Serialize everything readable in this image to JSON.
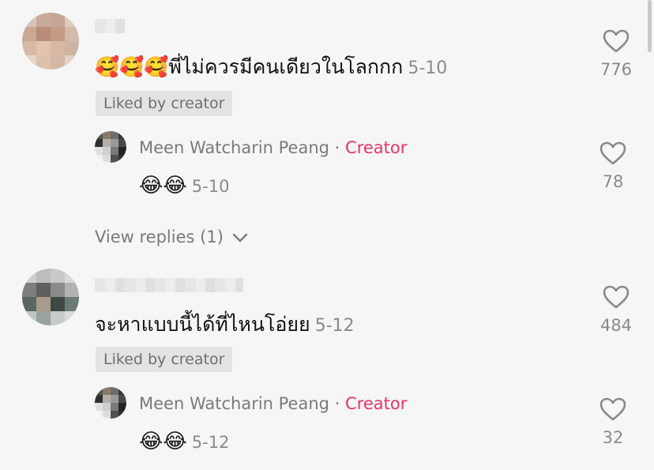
{
  "comments": [
    {
      "text": "🥰🥰🥰พี่ไม่ควรมีคนเดียวในโลกกก",
      "date": "5-10",
      "liked_label": "Liked by creator",
      "likes": "776",
      "reply": {
        "author": "Meen Watcharin Peang",
        "separator": " · ",
        "badge": "Creator",
        "text": "😂😂",
        "date": "5-10",
        "likes": "78"
      },
      "view_replies": "View replies (1)"
    },
    {
      "text": "จะหาแบบนี้ได้ที่ไหนโอ่ยย",
      "date": "5-12",
      "liked_label": "Liked by creator",
      "likes": "484",
      "reply": {
        "author": "Meen Watcharin Peang",
        "separator": " · ",
        "badge": "Creator",
        "text": "😂😂",
        "date": "5-12",
        "likes": "32"
      }
    }
  ],
  "colors": {
    "background": "#f6f6f6",
    "creator_badge": "#e8336b",
    "muted_text": "#8a8a8a",
    "liked_chip": "#e3e3e3"
  }
}
